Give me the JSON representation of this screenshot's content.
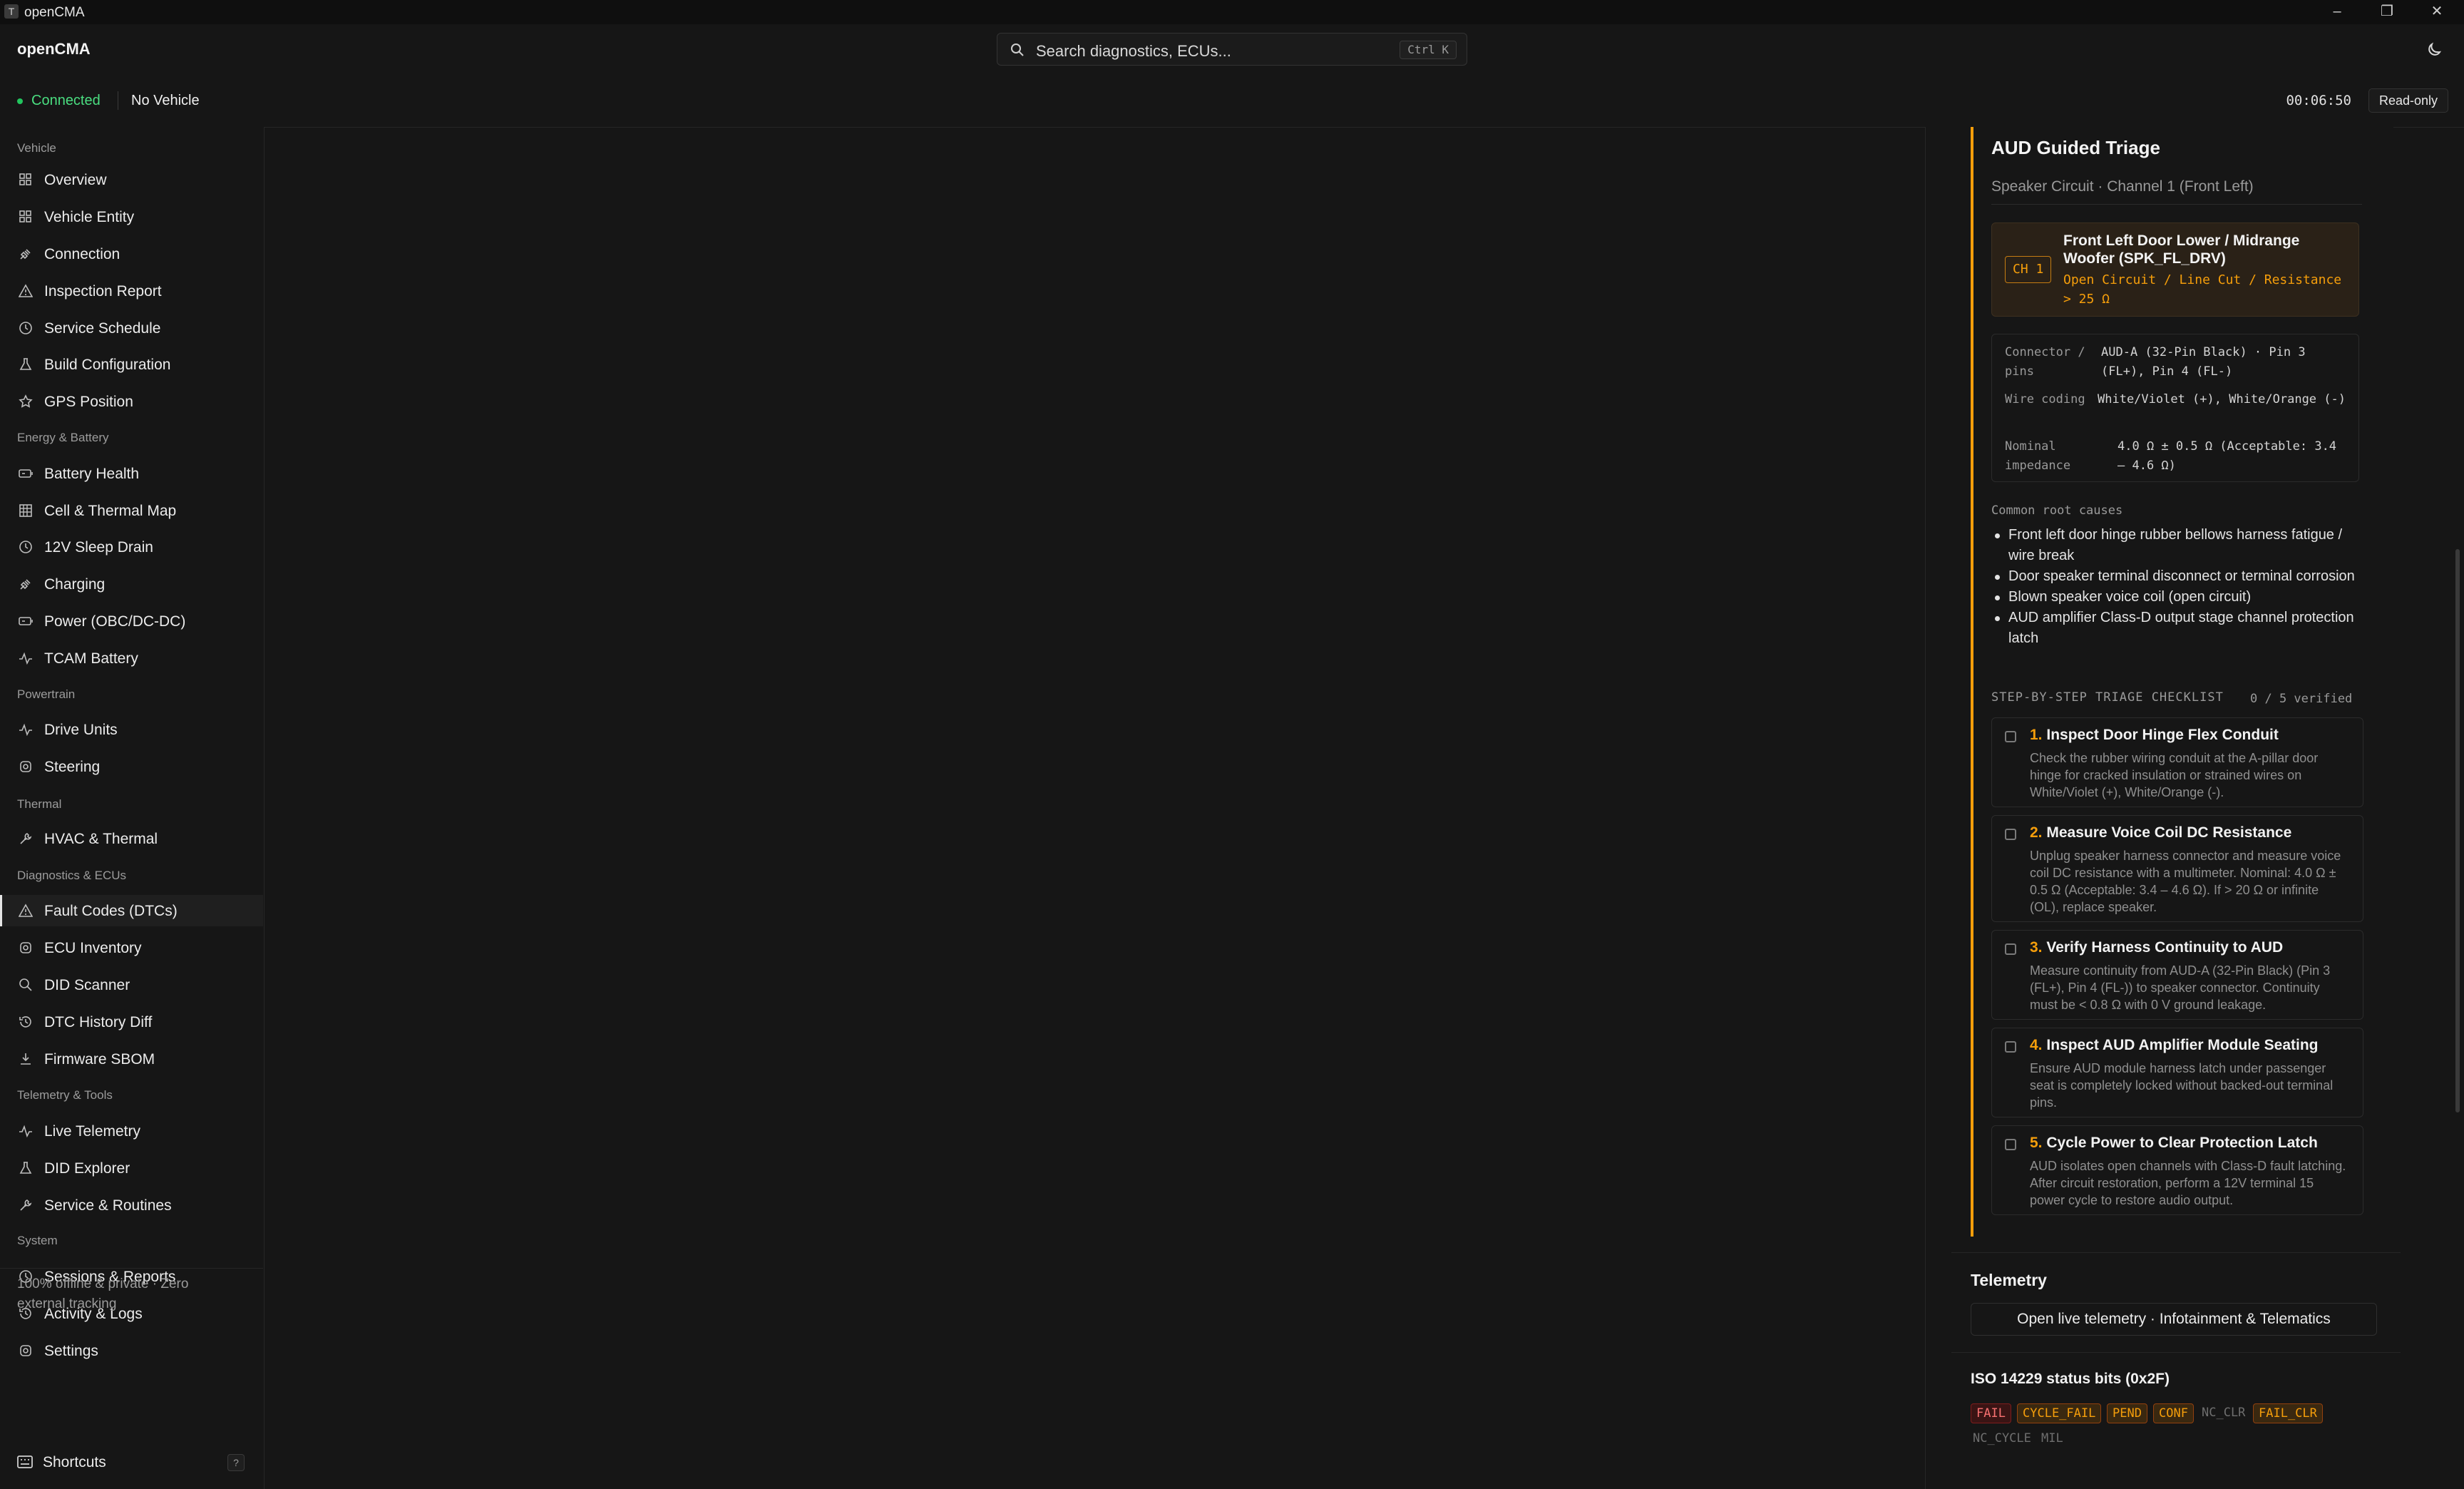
{
  "window": {
    "title": "openCMA"
  },
  "header": {
    "brand": "openCMA",
    "search_placeholder": "Search diagnostics, ECUs...",
    "search_shortcut": "Ctrl K"
  },
  "status": {
    "connection": "Connected",
    "vehicle": "No Vehicle",
    "timer": "00:06:50",
    "mode": "Read-only"
  },
  "sidebar": {
    "groups": [
      "Vehicle",
      "Energy & Battery",
      "Powertrain",
      "Thermal",
      "Diagnostics & ECUs",
      "Telemetry & Tools",
      "System"
    ],
    "items": [
      {
        "label": "Overview",
        "icon": "grid-icon"
      },
      {
        "label": "Vehicle Entity",
        "icon": "grid-icon"
      },
      {
        "label": "Connection",
        "icon": "plug-icon"
      },
      {
        "label": "Inspection Report",
        "icon": "warning-icon"
      },
      {
        "label": "Service Schedule",
        "icon": "clock-icon"
      },
      {
        "label": "Build Configuration",
        "icon": "flask-icon"
      },
      {
        "label": "GPS Position",
        "icon": "star-icon"
      },
      {
        "label": "Battery Health",
        "icon": "battery-icon"
      },
      {
        "label": "Cell & Thermal Map",
        "icon": "table-icon"
      },
      {
        "label": "12V Sleep Drain",
        "icon": "clock-icon"
      },
      {
        "label": "Charging",
        "icon": "plug-icon"
      },
      {
        "label": "Power (OBC/DC-DC)",
        "icon": "battery-icon"
      },
      {
        "label": "TCAM Battery",
        "icon": "pulse-icon"
      },
      {
        "label": "Drive Units",
        "icon": "pulse-icon"
      },
      {
        "label": "Steering",
        "icon": "gear-icon"
      },
      {
        "label": "HVAC & Thermal",
        "icon": "wrench-icon"
      },
      {
        "label": "Fault Codes (DTCs)",
        "icon": "warning-icon"
      },
      {
        "label": "ECU Inventory",
        "icon": "gear-icon"
      },
      {
        "label": "DID Scanner",
        "icon": "search-icon"
      },
      {
        "label": "DTC History Diff",
        "icon": "history-icon"
      },
      {
        "label": "Firmware SBOM",
        "icon": "download-icon"
      },
      {
        "label": "Live Telemetry",
        "icon": "pulse-icon"
      },
      {
        "label": "DID Explorer",
        "icon": "flask-icon"
      },
      {
        "label": "Service & Routines",
        "icon": "wrench-icon"
      },
      {
        "label": "Sessions & Reports",
        "icon": "clock-icon"
      },
      {
        "label": "Activity & Logs",
        "icon": "history-icon"
      },
      {
        "label": "Settings",
        "icon": "gear-icon"
      }
    ],
    "active": "Fault Codes (DTCs)",
    "footer_note": "100% offline & private · Zero external tracking",
    "shortcuts_label": "Shortcuts",
    "shortcuts_key": "?"
  },
  "triage": {
    "title": "AUD Guided Triage",
    "subtitle": "Speaker Circuit · Channel 1 (Front Left)",
    "channel_tag": "CH 1",
    "channel_name": "Front Left Door Lower / Midrange Woofer (SPK_FL_DRV)",
    "fault": "Open Circuit / Line Cut / Resistance > 25 Ω",
    "specs": [
      {
        "key": "Connector / pins",
        "value": "AUD-A (32-Pin Black) · Pin 3 (FL+), Pin 4 (FL-)"
      },
      {
        "key": "Wire coding",
        "value": "White/Violet (+), White/Orange (-)"
      },
      {
        "key": "Nominal impedance",
        "value": "4.0 Ω ± 0.5 Ω (Acceptable: 3.4 – 4.6 Ω)"
      }
    ],
    "root_causes_heading": "Common root causes",
    "root_causes": [
      "Front left door hinge rubber bellows harness fatigue / wire break",
      "Door speaker terminal disconnect or terminal corrosion",
      "Blown speaker voice coil (open circuit)",
      "AUD amplifier Class-D output stage channel protection latch"
    ],
    "checklist_heading": "STEP-BY-STEP TRIAGE CHECKLIST",
    "checklist_count": "0 / 5 verified",
    "steps": [
      {
        "num": "1.",
        "title": "Inspect Door Hinge Flex Conduit",
        "desc": "Check the rubber wiring conduit at the A-pillar door hinge for cracked insulation or strained wires on White/Violet (+), White/Orange (-)."
      },
      {
        "num": "2.",
        "title": "Measure Voice Coil DC Resistance",
        "desc": "Unplug speaker harness connector and measure voice coil DC resistance with a multimeter. Nominal: 4.0 Ω ± 0.5 Ω (Acceptable: 3.4 – 4.6 Ω). If > 20 Ω or infinite (OL), replace speaker."
      },
      {
        "num": "3.",
        "title": "Verify Harness Continuity to AUD",
        "desc": "Measure continuity from AUD-A (32-Pin Black) (Pin 3 (FL+), Pin 4 (FL-)) to speaker connector. Continuity must be < 0.8 Ω with 0 V ground leakage."
      },
      {
        "num": "4.",
        "title": "Inspect AUD Amplifier Module Seating",
        "desc": "Ensure AUD module harness latch under passenger seat is completely locked without backed-out terminal pins."
      },
      {
        "num": "5.",
        "title": "Cycle Power to Clear Protection Latch",
        "desc": "AUD isolates open channels with Class-D fault latching. After circuit restoration, perform a 12V terminal 15 power cycle to restore audio output."
      }
    ]
  },
  "telemetry": {
    "heading": "Telemetry",
    "button": "Open live telemetry · Infotainment & Telematics"
  },
  "iso": {
    "heading": "ISO 14229 status bits (0x2F)",
    "bits": [
      {
        "label": "FAIL",
        "state": "red"
      },
      {
        "label": "CYCLE_FAIL",
        "state": "amber"
      },
      {
        "label": "PEND",
        "state": "amber"
      },
      {
        "label": "CONF",
        "state": "amber"
      },
      {
        "label": "NC_CLR",
        "state": "off"
      },
      {
        "label": "FAIL_CLR",
        "state": "amber"
      },
      {
        "label": "NC_CYCLE",
        "state": "off"
      },
      {
        "label": "MIL",
        "state": "off"
      }
    ]
  },
  "colors": {
    "accent": "#f59e0b",
    "connected": "#4ade80",
    "fail": "#f87171",
    "background": "#161616"
  }
}
